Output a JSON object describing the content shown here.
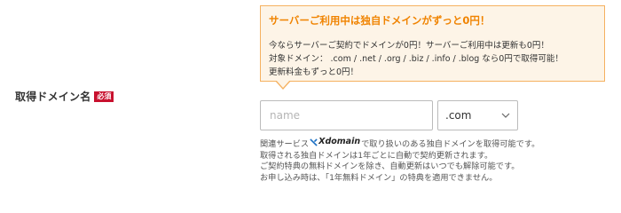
{
  "field": {
    "label": "取得ドメイン名",
    "required_badge": "必須"
  },
  "promo": {
    "title": "サーバーご利用中は独自ドメインがずっと0円！",
    "lines": [
      "今ならサーバーご契約でドメインが0円！サーバーご利用中は更新も0円！",
      "対象ドメイン： .com / .net / .org / .biz / .info / .blog なら0円で取得可能！",
      "更新料金もずっと0円！"
    ]
  },
  "name_input": {
    "placeholder": "name",
    "value": ""
  },
  "tld_select": {
    "selected": ".com"
  },
  "notes": {
    "line1_prefix": "関連サービス",
    "logo_text": "Xdomain",
    "line1_suffix": "で取り扱いのある独自ドメインを取得可能です。",
    "lines": [
      "取得される独自ドメインは1年ごとに自動で契約更新されます。",
      "ご契約特典の無料ドメインを除き、自動更新はいつでも解除可能です。",
      "お申し込み時は、「1年無料ドメイン」の特典を適用できません。"
    ]
  },
  "colors": {
    "accent_orange": "#f08300",
    "promo_bg": "#fdf4e7",
    "promo_border": "#f5b160",
    "required_red": "#c8102e"
  },
  "icons": {
    "select_chevron": "chevron-down-icon",
    "logo": "xdomain-logo-icon"
  }
}
